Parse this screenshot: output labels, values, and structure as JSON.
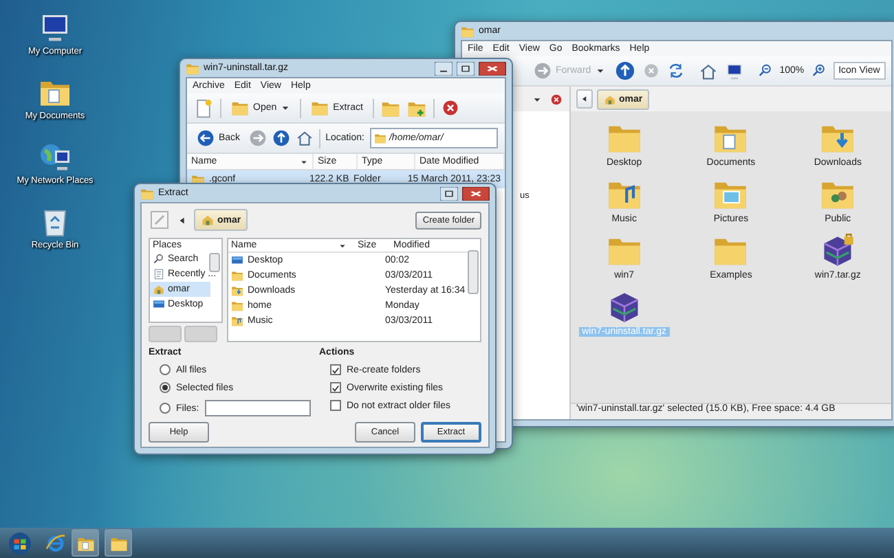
{
  "desktop_icons": [
    {
      "label": "My Computer",
      "kind": "computer"
    },
    {
      "label": "My Documents",
      "kind": "documents"
    },
    {
      "label": "My Network Places",
      "kind": "network"
    },
    {
      "label": "Recycle Bin",
      "kind": "bin"
    }
  ],
  "file_manager": {
    "title": "omar",
    "menu": [
      "File",
      "Edit",
      "View",
      "Go",
      "Bookmarks",
      "Help"
    ],
    "toolbar": {
      "forward": {
        "label": "Forward",
        "disabled": true
      },
      "zoom": "100%",
      "view_mode": "Icon View"
    },
    "sidebar_text": "us",
    "path": "omar",
    "items": [
      {
        "label": "Desktop",
        "kind": "folder",
        "selected": false
      },
      {
        "label": "Documents",
        "kind": "documents",
        "selected": false
      },
      {
        "label": "Downloads",
        "kind": "downloads",
        "selected": false
      },
      {
        "label": "Music",
        "kind": "music",
        "selected": false
      },
      {
        "label": "Pictures",
        "kind": "pictures",
        "selected": false
      },
      {
        "label": "Public",
        "kind": "public",
        "selected": false
      },
      {
        "label": "win7",
        "kind": "folder",
        "selected": false
      },
      {
        "label": "Examples",
        "kind": "folder",
        "selected": false
      },
      {
        "label": "win7.tar.gz",
        "kind": "locked-archive",
        "selected": false
      },
      {
        "label": "win7-uninstall.tar.gz",
        "kind": "archive",
        "selected": true
      }
    ],
    "status_bar": "'win7-uninstall.tar.gz' selected (15.0 KB), Free space: 4.4 GB"
  },
  "archive_manager": {
    "title": "win7-uninstall.tar.gz",
    "menu": [
      "Archive",
      "Edit",
      "View",
      "Help"
    ],
    "toolbar": {
      "open": "Open",
      "extract": "Extract"
    },
    "nav": {
      "back": "Back",
      "location_label": "Location:",
      "location": "/home/omar/"
    },
    "columns": [
      "Name",
      "Size",
      "Type",
      "Date Modified"
    ],
    "rows": [
      {
        "name": ".gconf",
        "size": "122.2 KB",
        "type": "Folder",
        "modified": "15 March 2011, 23:23",
        "selected": true
      }
    ]
  },
  "extract_dialog": {
    "title": "Extract",
    "path": "omar",
    "create_folder": "Create folder",
    "places_header": "Places",
    "places": [
      {
        "label": "Search",
        "kind": "search",
        "selected": false
      },
      {
        "label": "Recently ...",
        "kind": "recent",
        "selected": false
      },
      {
        "label": "omar",
        "kind": "home",
        "selected": true
      },
      {
        "label": "Desktop",
        "kind": "desktop",
        "selected": false
      }
    ],
    "columns": [
      "Name",
      "Size",
      "Modified"
    ],
    "files": [
      {
        "name": "Desktop",
        "kind": "desktop",
        "modified": "00:02"
      },
      {
        "name": "Documents",
        "kind": "folder",
        "modified": "03/03/2011"
      },
      {
        "name": "Downloads",
        "kind": "downloads",
        "modified": "Yesterday at 16:34"
      },
      {
        "name": "home",
        "kind": "folder",
        "modified": "Monday"
      },
      {
        "name": "Music",
        "kind": "music",
        "modified": "03/03/2011"
      }
    ],
    "extract_header": "Extract",
    "options": [
      {
        "label": "All files",
        "selected": false
      },
      {
        "label": "Selected files",
        "selected": true
      },
      {
        "label": "Files:",
        "selected": false
      }
    ],
    "actions_header": "Actions",
    "actions": [
      {
        "label": "Re-create folders",
        "checked": true
      },
      {
        "label": "Overwrite existing files",
        "checked": true
      },
      {
        "label": "Do not extract older files",
        "checked": false
      }
    ],
    "buttons": {
      "help": "Help",
      "cancel": "Cancel",
      "extract": "Extract"
    }
  }
}
